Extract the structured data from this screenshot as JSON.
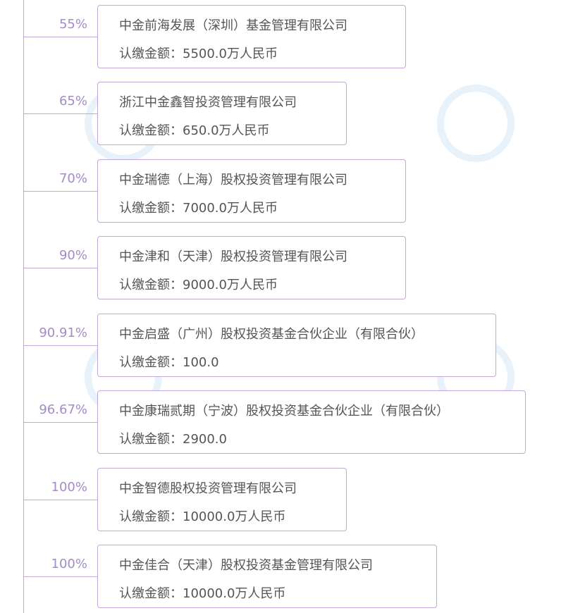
{
  "amount_label": "认缴金额：",
  "entries": [
    {
      "pct": "55%",
      "name": "中金前海发展（深圳）基金管理有限公司",
      "amount": "5500.0万人民币"
    },
    {
      "pct": "65%",
      "name": "浙江中金鑫智投资管理有限公司",
      "amount": "650.0万人民币"
    },
    {
      "pct": "70%",
      "name": "中金瑞德（上海）股权投资管理有限公司",
      "amount": "7000.0万人民币"
    },
    {
      "pct": "90%",
      "name": "中金津和（天津）股权投资管理有限公司",
      "amount": "9000.0万人民币"
    },
    {
      "pct": "90.91%",
      "name": "中金启盛（广州）股权投资基金合伙企业（有限合伙）",
      "amount": "100.0"
    },
    {
      "pct": "96.67%",
      "name": "中金康瑞贰期（宁波）股权投资基金合伙企业（有限合伙）",
      "amount": "2900.0"
    },
    {
      "pct": "100%",
      "name": "中金智德股权投资管理有限公司",
      "amount": "10000.0万人民币"
    },
    {
      "pct": "100%",
      "name": "中金佳合（天津）股权投资基金管理有限公司",
      "amount": "10000.0万人民币"
    }
  ]
}
